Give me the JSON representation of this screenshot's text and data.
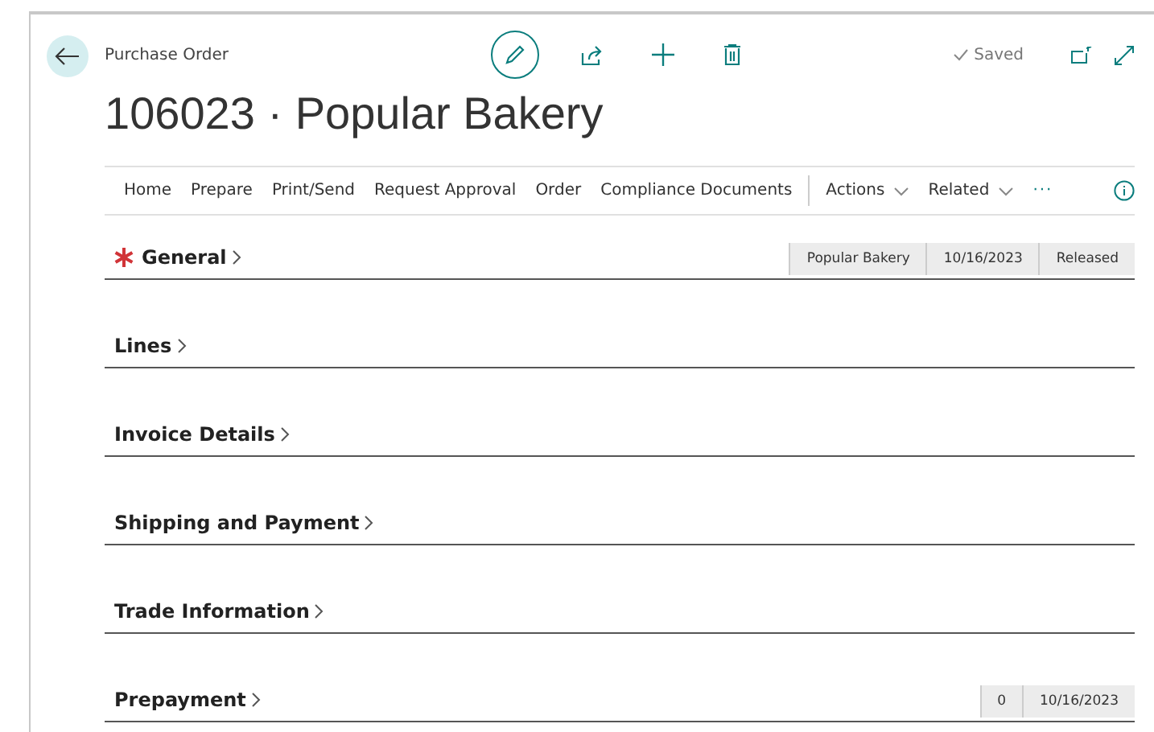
{
  "header": {
    "caption": "Purchase Order",
    "title": "106023 · Popular Bakery",
    "status": "Saved"
  },
  "menu": {
    "items": [
      "Home",
      "Prepare",
      "Print/Send",
      "Request Approval",
      "Order",
      "Compliance Documents"
    ],
    "dropdowns": [
      "Actions",
      "Related"
    ],
    "more": "···"
  },
  "sections": [
    {
      "title": "General",
      "required": true,
      "summary": [
        "Popular Bakery",
        "10/16/2023",
        "Released"
      ]
    },
    {
      "title": "Lines",
      "required": false
    },
    {
      "title": "Invoice Details",
      "required": false
    },
    {
      "title": "Shipping and Payment",
      "required": false
    },
    {
      "title": "Trade Information",
      "required": false
    },
    {
      "title": "Prepayment",
      "required": false,
      "summary": [
        "0",
        "10/16/2023"
      ]
    }
  ]
}
